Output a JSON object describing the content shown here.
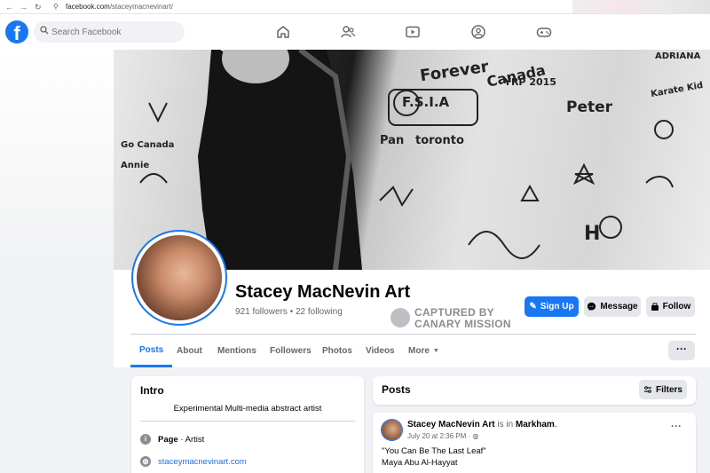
{
  "browser": {
    "url_host": "facebook.com",
    "url_path": "/staceymacnevinart/"
  },
  "search": {
    "placeholder": "Search Facebook"
  },
  "nav_icons": [
    "home-icon",
    "friends-icon",
    "video-icon",
    "groups-icon",
    "gaming-icon"
  ],
  "cover": {
    "wall_words": [
      "Forever",
      "Canada",
      "F.S.I.A",
      "Peter",
      "Pan",
      "toronto",
      "YRP 2015",
      "Karate Kid",
      "Annie",
      "Go Canada",
      "H",
      "ADRIANA"
    ]
  },
  "profile": {
    "name": "Stacey MacNevin Art",
    "stats": "921 followers • 22 following"
  },
  "watermark": {
    "line1": "CAPTURED BY",
    "line2": "CANARY MISSION"
  },
  "actions": {
    "signup": "Sign Up",
    "message": "Message",
    "follow": "Follow"
  },
  "tabs": [
    "Posts",
    "About",
    "Mentions",
    "Followers",
    "Photos",
    "Videos",
    "More"
  ],
  "intro": {
    "title": "Intro",
    "bio": "Experimental Multi-media abstract artist",
    "page_label": "Page",
    "page_category": " · Artist",
    "website": "staceymacnevinart.com"
  },
  "posts": {
    "title": "Posts",
    "filters": "Filters",
    "post": {
      "author": "Stacey MacNevin Art",
      "is_in": " is in ",
      "location": "Markham",
      "date": "July 20 at 2:36 PM · ",
      "text_line1": "\"You Can Be The Last Leaf\"",
      "text_line2": "Maya Abu Al-Hayyat"
    }
  },
  "colors": {
    "accent": "#1877f2",
    "bg": "#f0f2f5"
  }
}
